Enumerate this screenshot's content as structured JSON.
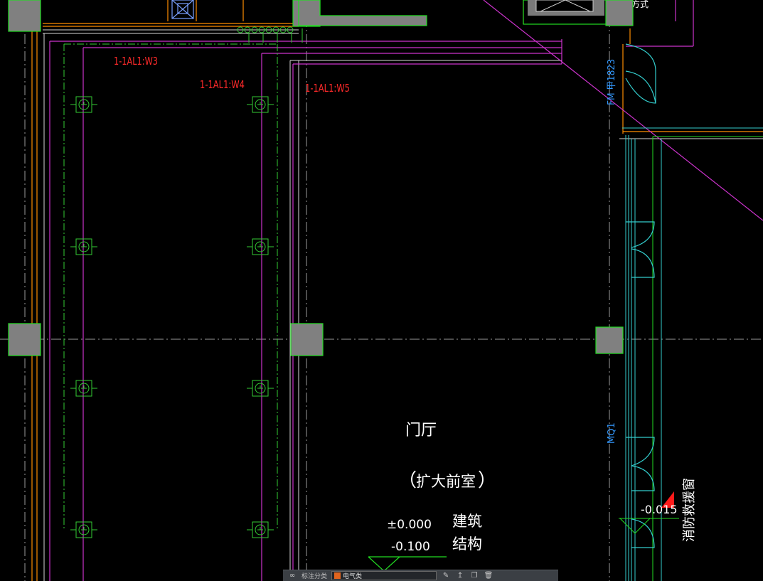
{
  "labels": {
    "circuit_w3": "1-1AL1:W3",
    "circuit_w4": "1-1AL1:W4",
    "circuit_w5": "1-1AL1:W5",
    "door_fm": "FM 甲1823",
    "door_mq": "MQ1",
    "room_name": "门厅",
    "room_sub_open": "（",
    "room_sub": "扩大前室",
    "room_sub_close": "）",
    "elev_arch": "±0.000",
    "elev_arch_label": "建筑",
    "elev_struct": "-0.100",
    "elev_struct_label": "结构",
    "elev_window": "-0.015",
    "rescue_window": "消防救援窗"
  },
  "toolbar": {
    "layer_label": "标注分类",
    "layer_value": "电气类",
    "layer_color": "#e0641e"
  },
  "colors": {
    "background": "#000000",
    "wall_outline": "#ff8c00",
    "power_line": "#cc33cc",
    "lighting_green": "#33cc33",
    "column_fill": "#808080",
    "column_edge": "#22dd22",
    "glass_cyan": "#33cccc",
    "door_blue": "#3399ff",
    "circuit_text": "#ff2a2a",
    "annotation_white": "#ffffff"
  }
}
